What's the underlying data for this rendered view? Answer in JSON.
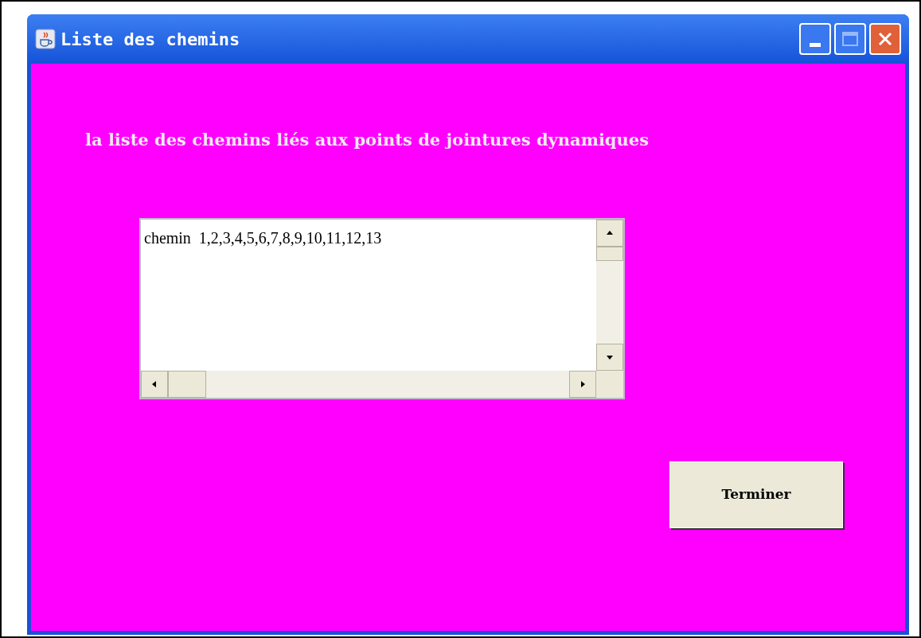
{
  "window": {
    "title": "Liste des chemins"
  },
  "heading": "la liste des chemins liés aux points de jointures dynamiques",
  "list": {
    "lines": [
      "chemin  1,2,3,4,5,6,7,8,9,10,11,12,13"
    ]
  },
  "buttons": [
    "Terminer"
  ]
}
